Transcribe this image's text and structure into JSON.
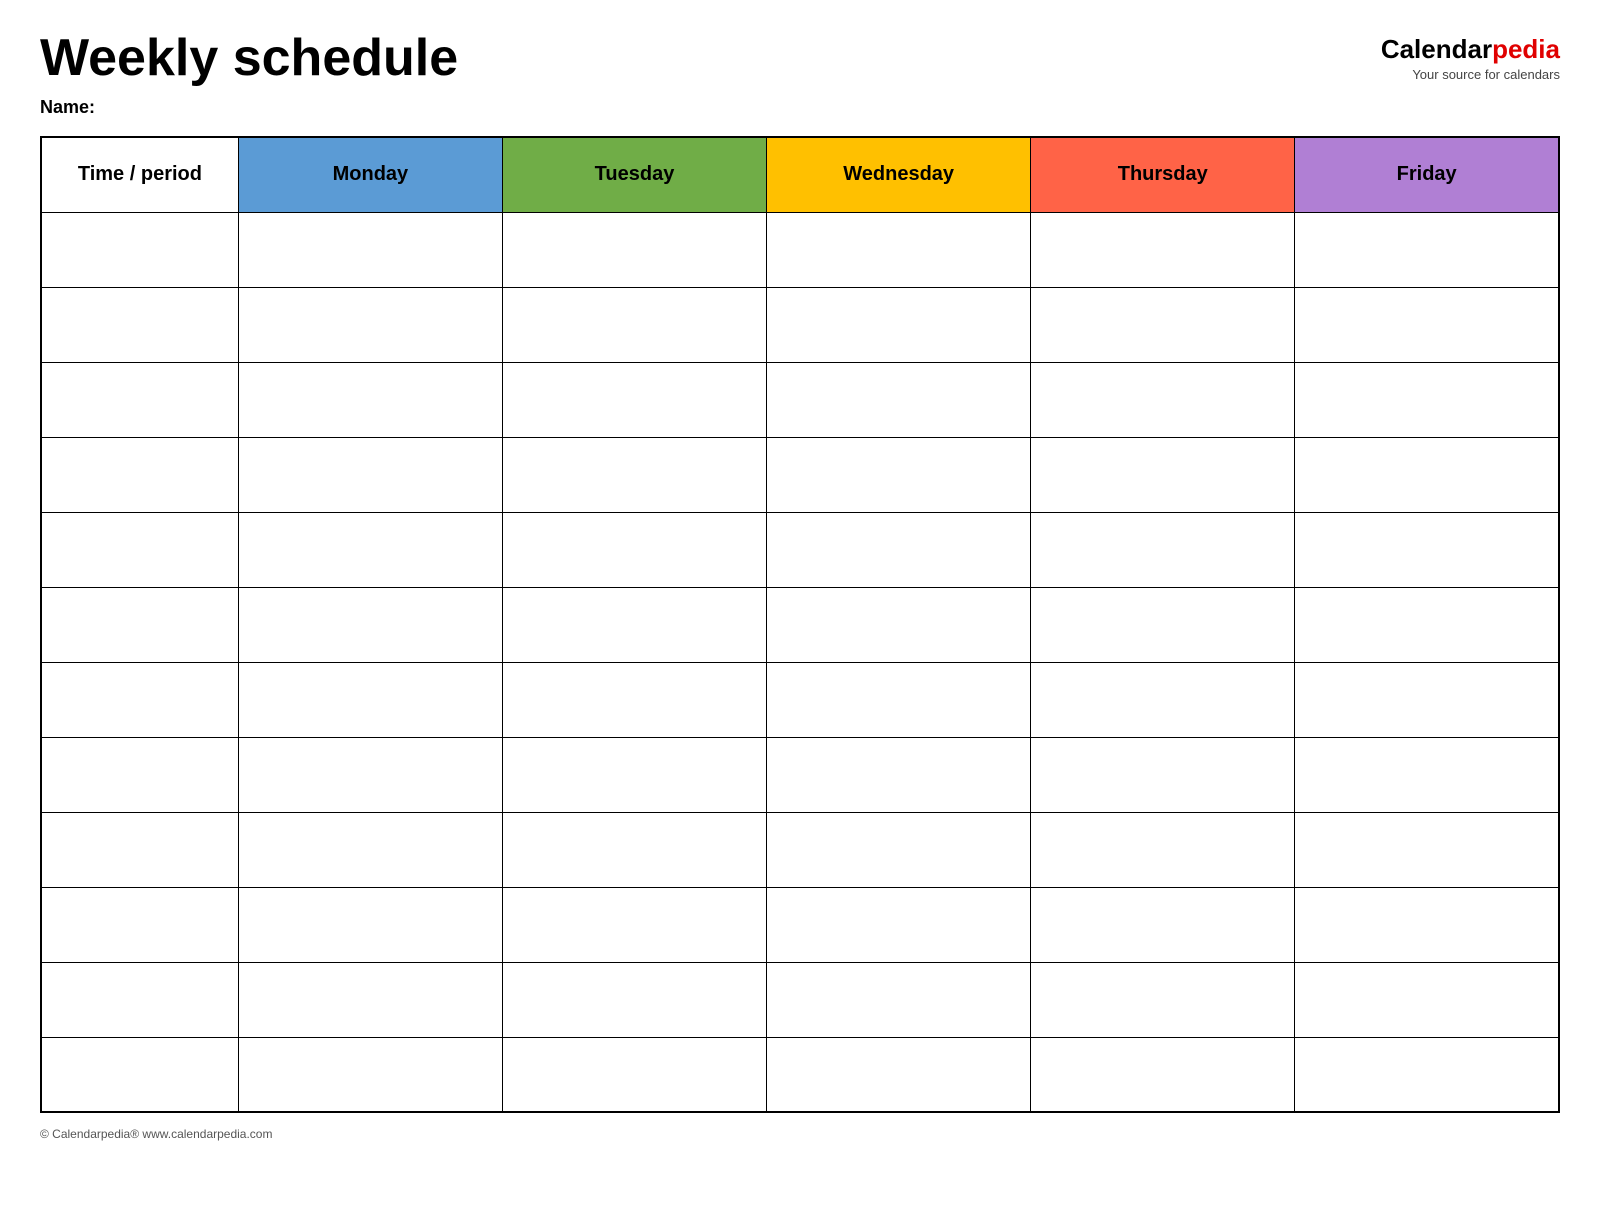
{
  "header": {
    "title": "Weekly schedule",
    "logo_calendar": "Calendar",
    "logo_pedia": "pedia",
    "logo_tagline": "Your source for calendars"
  },
  "name_label": "Name:",
  "table": {
    "columns": [
      {
        "id": "time",
        "label": "Time / period",
        "color": "#fff"
      },
      {
        "id": "monday",
        "label": "Monday",
        "color": "#5b9bd5"
      },
      {
        "id": "tuesday",
        "label": "Tuesday",
        "color": "#70ad47"
      },
      {
        "id": "wednesday",
        "label": "Wednesday",
        "color": "#ffc000"
      },
      {
        "id": "thursday",
        "label": "Thursday",
        "color": "#ff6347"
      },
      {
        "id": "friday",
        "label": "Friday",
        "color": "#b07fd4"
      }
    ],
    "row_count": 12
  },
  "footer": {
    "text": "© Calendarpedia®  www.calendarpedia.com"
  }
}
